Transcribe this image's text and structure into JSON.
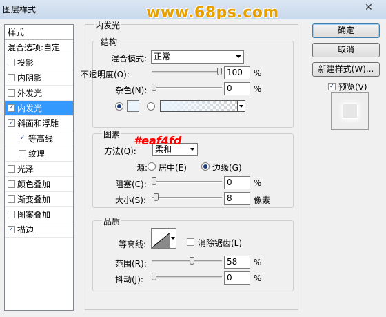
{
  "window": {
    "title": "图层样式",
    "close_label": "✕",
    "watermark": "www.68ps.com"
  },
  "styles": {
    "header": "样式",
    "blend_options": "混合选项:自定",
    "items": [
      {
        "label": "投影",
        "checked": false
      },
      {
        "label": "内阴影",
        "checked": false
      },
      {
        "label": "外发光",
        "checked": false
      },
      {
        "label": "内发光",
        "checked": true,
        "selected": true
      },
      {
        "label": "斜面和浮雕",
        "checked": true
      },
      {
        "label": "等高线",
        "checked": true,
        "sub": true
      },
      {
        "label": "纹理",
        "checked": false,
        "sub": true
      },
      {
        "label": "光泽",
        "checked": false
      },
      {
        "label": "颜色叠加",
        "checked": false
      },
      {
        "label": "渐变叠加",
        "checked": false
      },
      {
        "label": "图案叠加",
        "checked": false
      },
      {
        "label": "描边",
        "checked": true
      }
    ]
  },
  "panel": {
    "title": "内发光",
    "structure": {
      "title": "结构",
      "blend_mode_label": "混合模式:",
      "blend_mode_value": "正常",
      "opacity_label": "不透明度(O):",
      "opacity_value": "100",
      "noise_label": "杂色(N):",
      "noise_value": "0",
      "percent": "%",
      "solid_color": "#eaf4fd",
      "color_mode": "solid"
    },
    "annotation": "#eaf4fd",
    "elements": {
      "title": "图素",
      "method_label": "方法(Q):",
      "method_value": "柔和",
      "source_label": "源:",
      "source_center": "居中(E)",
      "source_edge": "边缘(G)",
      "source_selected": "edge",
      "choke_label": "阻塞(C):",
      "choke_value": "0",
      "size_label": "大小(S):",
      "size_value": "8",
      "size_unit": "像素",
      "percent": "%"
    },
    "quality": {
      "title": "品质",
      "contour_label": "等高线:",
      "antialias_label": "消除锯齿(L)",
      "antialias_checked": false,
      "range_label": "范围(R):",
      "range_value": "58",
      "jitter_label": "抖动(J):",
      "jitter_value": "0",
      "percent": "%"
    }
  },
  "buttons": {
    "ok": "确定",
    "cancel": "取消",
    "new_style": "新建样式(W)...",
    "preview_label": "预览(V)",
    "preview_checked": true
  },
  "sliders": {
    "opacity": 1.0,
    "noise": 0.0,
    "choke": 0.0,
    "size": 0.03,
    "range": 0.58,
    "jitter": 0.0
  },
  "icons": {
    "checkmark": "check-icon",
    "dropdown": "chevron-down-icon"
  }
}
